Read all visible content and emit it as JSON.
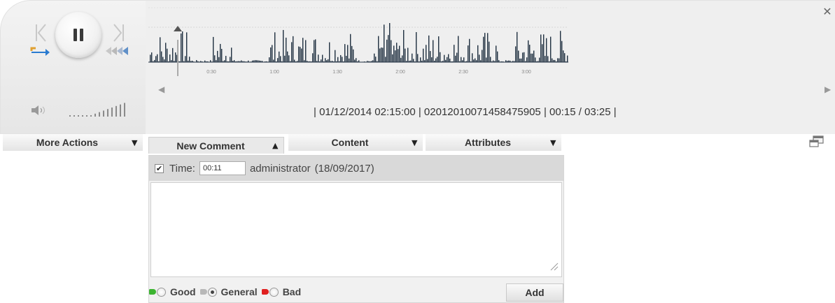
{
  "player": {
    "icons": [
      "prev-icon",
      "pause-icon",
      "next-icon",
      "loop-icon",
      "fast-forward-icon",
      "volume-icon",
      "volume-slider"
    ]
  },
  "timeline": {
    "ticks": [
      "0:30",
      "1:00",
      "1:30",
      "2:00",
      "2:30",
      "3:00"
    ],
    "position_fraction": 0.07,
    "info": "| 01/12/2014 02:15:00 |  02012010071458475905 |  00:15 / 03:25 |",
    "close_glyph": "✕",
    "left_arrow": "◀",
    "right_arrow": "▶"
  },
  "actions": {
    "more_actions": "More Actions",
    "new_comment": "New Comment",
    "content": "Content",
    "attributes": "Attributes",
    "arrow_down": "▼",
    "arrow_up": "▲"
  },
  "comment": {
    "checked_glyph": "✔",
    "time_label": "Time:",
    "time_value": "00:11",
    "user": "administrator",
    "date": "(18/09/2017)",
    "text": "",
    "ratings": [
      {
        "label": "Good",
        "color": "#3cb431",
        "checked": false
      },
      {
        "label": "General",
        "color": "#b8b8b8",
        "checked": true
      },
      {
        "label": "Bad",
        "color": "#e02020",
        "checked": false
      }
    ],
    "add_label": "Add"
  },
  "colors": {
    "waveform": "#1f2f40",
    "accent_bar": "#aaaaaa"
  }
}
